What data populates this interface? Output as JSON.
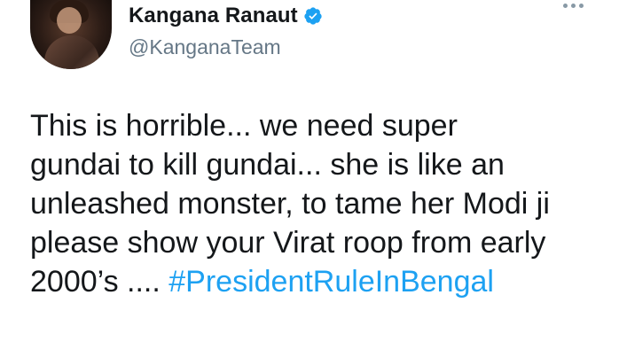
{
  "author": {
    "display_name": "Kangana Ranaut",
    "handle": "@KanganaTeam",
    "verified": true
  },
  "tweet": {
    "lines": [
      "This is horrible... we need super",
      "gundai to kill gundai... she is like an",
      "unleashed monster, to tame her Modi ji",
      "please show your Virat roop from early"
    ],
    "last_line_prefix": "2000’s .... ",
    "hashtag": "#PresidentRuleInBengal"
  },
  "colors": {
    "hashtag": "#1da1f2",
    "verified_badge": "#1da1f2",
    "handle": "#657786"
  },
  "icons": {
    "verified": "verified-badge-icon",
    "more": "more-options-icon"
  }
}
